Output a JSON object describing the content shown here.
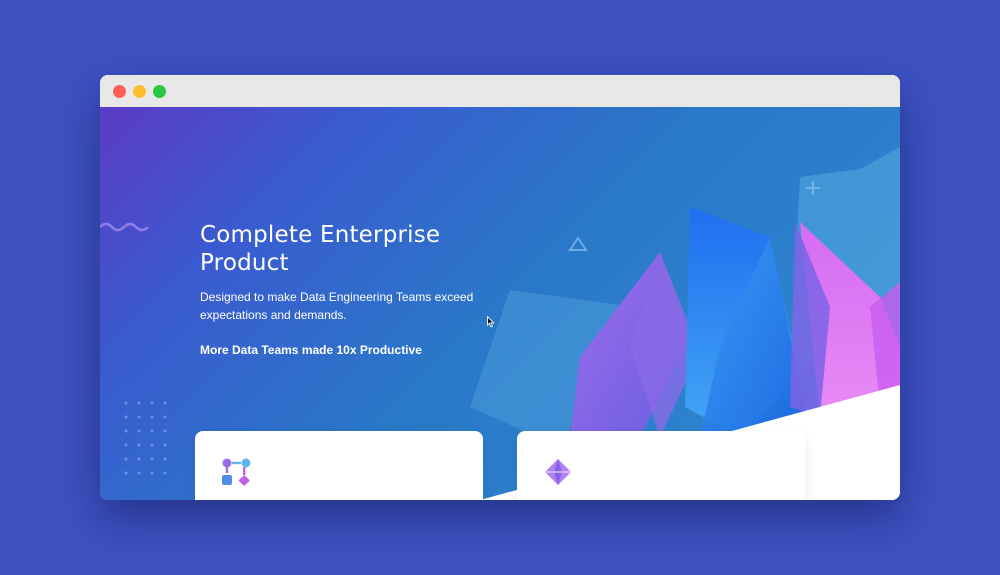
{
  "window": {
    "controls": [
      "close",
      "minimize",
      "maximize"
    ]
  },
  "hero": {
    "title": "Complete Enterprise Product",
    "subtitle": "Designed to make Data Engineering Teams exceed expectations and demands.",
    "highlight": "More Data Teams made 10x Productive"
  },
  "cards": [
    {
      "icon": "pipeline-icon"
    },
    {
      "icon": "crystal-icon"
    }
  ],
  "colors": {
    "page_bg": "#3d51c1",
    "gradient_start": "#5c3bc4",
    "gradient_end": "#2f8bd2",
    "crystal_blue": "#2f7df0",
    "crystal_purple": "#c56cf0"
  }
}
